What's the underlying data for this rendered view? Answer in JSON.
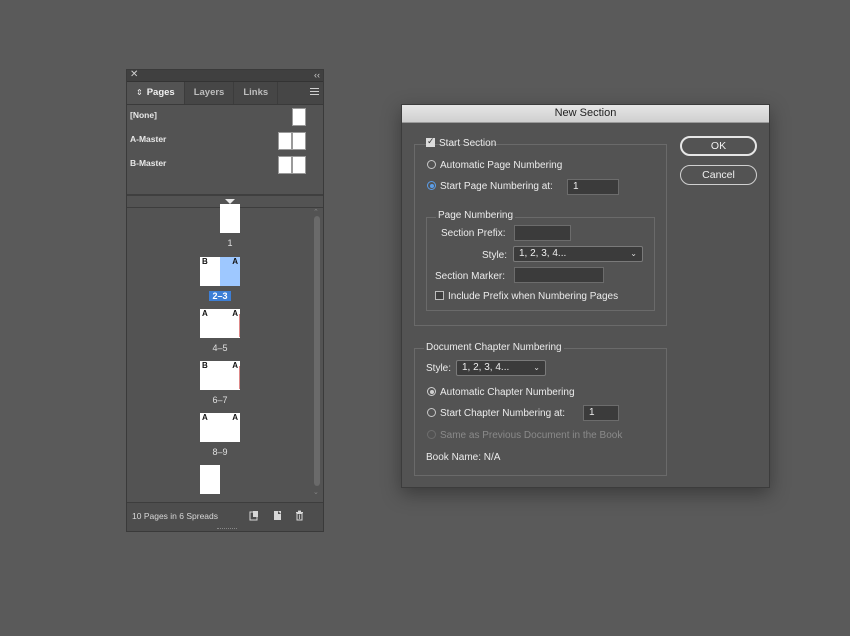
{
  "pages_panel": {
    "tabs": [
      {
        "label": "Pages",
        "active": true
      },
      {
        "label": "Layers",
        "active": false
      },
      {
        "label": "Links",
        "active": false
      }
    ],
    "masters": [
      {
        "label": "[None]"
      },
      {
        "label": "A-Master"
      },
      {
        "label": "B-Master"
      }
    ],
    "spreads": [
      {
        "label": "1",
        "selected": false,
        "left": null,
        "right": ""
      },
      {
        "label": "2–3",
        "selected": true,
        "left": "B",
        "right": "A"
      },
      {
        "label": "4–5",
        "selected": false,
        "left": "A",
        "right": "A"
      },
      {
        "label": "6–7",
        "selected": false,
        "left": "B",
        "right": "A"
      },
      {
        "label": "8–9",
        "selected": false,
        "left": "A",
        "right": "A"
      },
      {
        "label": "",
        "selected": false,
        "left": "",
        "right": null
      }
    ],
    "footer_text": "10 Pages in 6 Spreads"
  },
  "dialog": {
    "title": "New Section",
    "ok_label": "OK",
    "cancel_label": "Cancel",
    "start_section_label": "Start Section",
    "start_section_checked": true,
    "automatic_page_numbering_label": "Automatic Page Numbering",
    "start_page_numbering_label": "Start Page Numbering at:",
    "start_page_numbering_value": "1",
    "page_numbering_group": "Page Numbering",
    "section_prefix_label": "Section Prefix:",
    "section_prefix_value": "",
    "style_label": "Style:",
    "style_value": "1, 2, 3, 4...",
    "section_marker_label": "Section Marker:",
    "section_marker_value": "",
    "include_prefix_label": "Include Prefix when Numbering Pages",
    "include_prefix_checked": false,
    "chapter_group": "Document Chapter Numbering",
    "chapter_style_label": "Style:",
    "chapter_style_value": "1, 2, 3, 4...",
    "automatic_chapter_label": "Automatic Chapter Numbering",
    "start_chapter_label": "Start Chapter Numbering at:",
    "start_chapter_value": "1",
    "same_as_previous_label": "Same as Previous Document in the Book",
    "book_name_label": "Book Name: N/A"
  }
}
